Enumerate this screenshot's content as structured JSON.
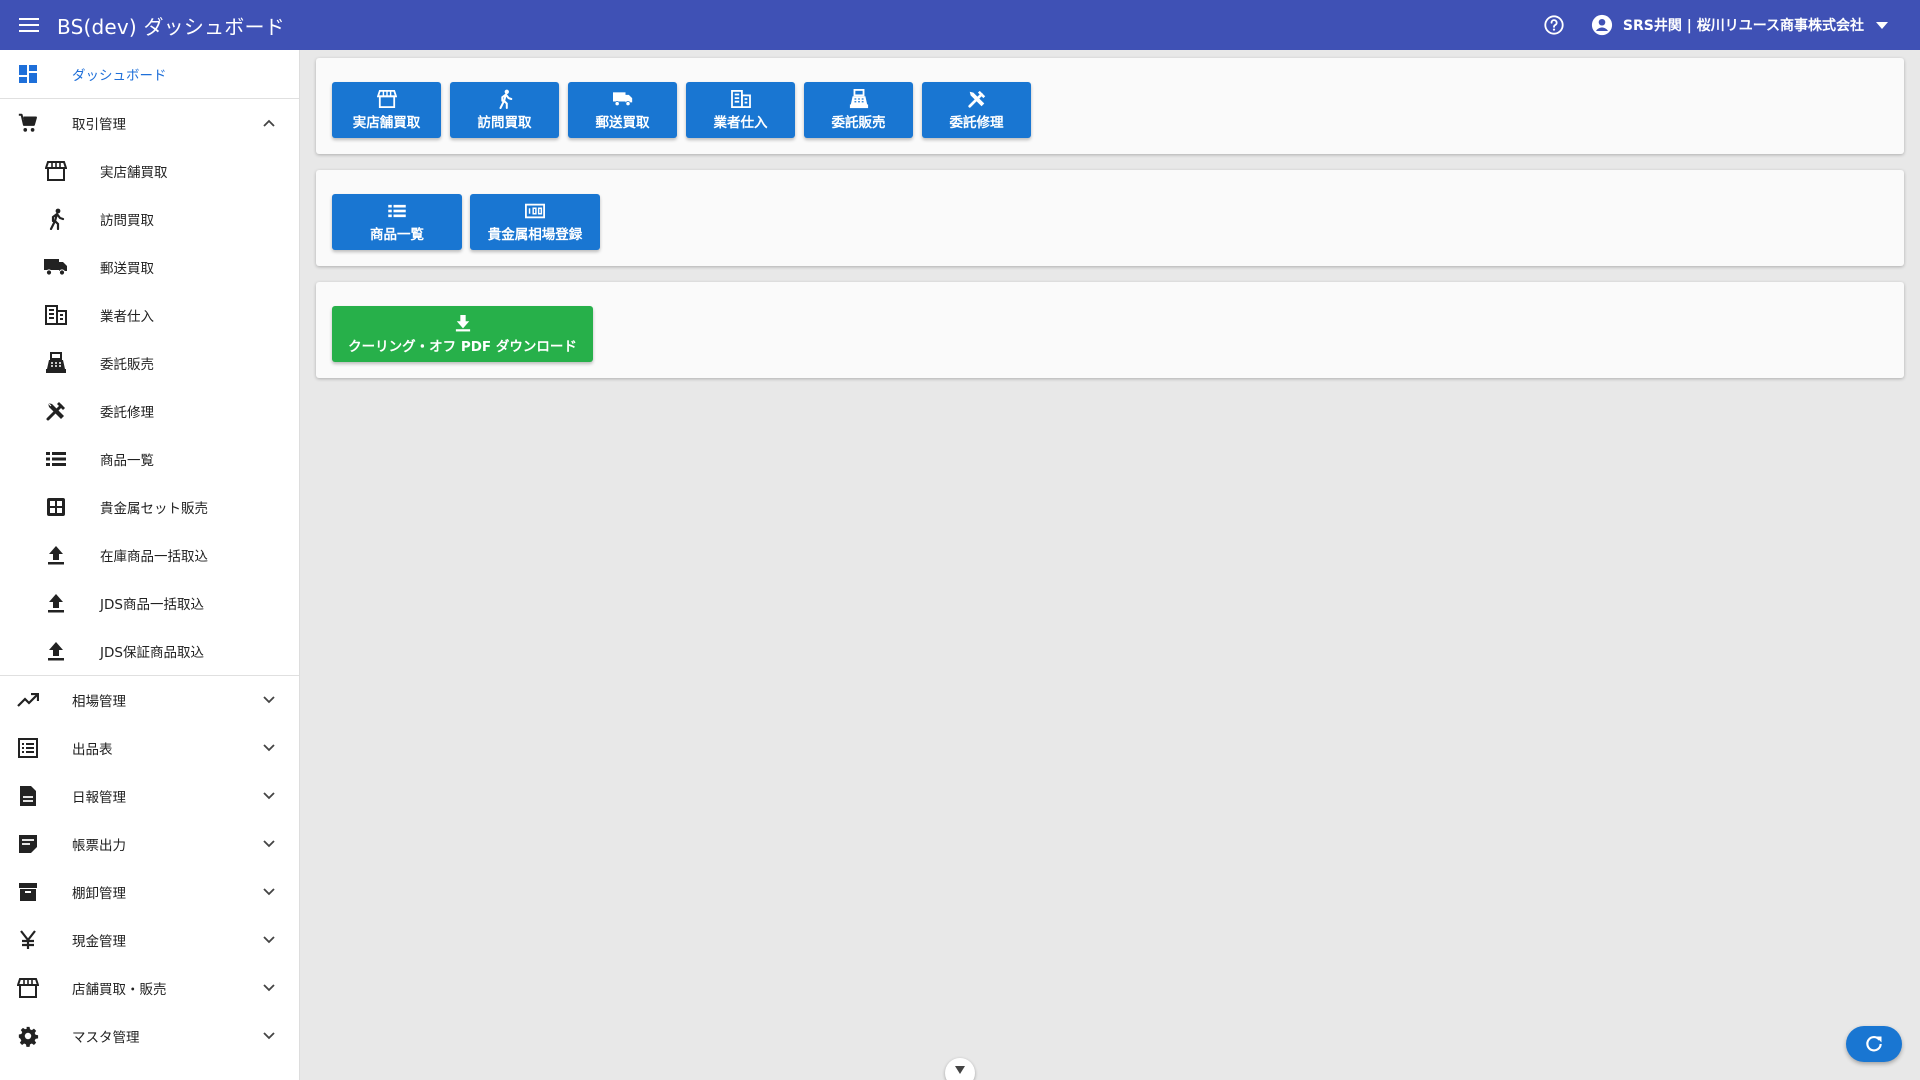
{
  "header": {
    "title": "BS(dev) ダッシュボード",
    "user_name": "SRS井関 | 桜川リユース商事株式会社"
  },
  "sidebar": {
    "dashboard": "ダッシュボード",
    "torihiki": {
      "label": "取引管理",
      "items": [
        {
          "label": "実店舗買取",
          "icon": "store-icon"
        },
        {
          "label": "訪問買取",
          "icon": "walk-icon"
        },
        {
          "label": "郵送買取",
          "icon": "truck-icon"
        },
        {
          "label": "業者仕入",
          "icon": "building-icon"
        },
        {
          "label": "委託販売",
          "icon": "register-icon"
        },
        {
          "label": "委託修理",
          "icon": "tools-icon"
        },
        {
          "label": "商品一覧",
          "icon": "list-icon"
        },
        {
          "label": "貴金属セット販売",
          "icon": "grid-icon"
        },
        {
          "label": "在庫商品一括取込",
          "icon": "upload-icon"
        },
        {
          "label": "JDS商品一括取込",
          "icon": "upload-icon"
        },
        {
          "label": "JDS保証商品取込",
          "icon": "upload-icon"
        }
      ]
    },
    "groups": [
      {
        "label": "相場管理",
        "icon": "trending-icon"
      },
      {
        "label": "出品表",
        "icon": "list-alt-icon"
      },
      {
        "label": "日報管理",
        "icon": "document-icon"
      },
      {
        "label": "帳票出力",
        "icon": "note-icon"
      },
      {
        "label": "棚卸管理",
        "icon": "archive-icon"
      },
      {
        "label": "現金管理",
        "icon": "yen-icon"
      },
      {
        "label": "店舗買取・販売",
        "icon": "store-icon"
      },
      {
        "label": "マスタ管理",
        "icon": "gear-icon"
      }
    ]
  },
  "main": {
    "row1": [
      "実店舗買取",
      "訪問買取",
      "郵送買取",
      "業者仕入",
      "委託販売",
      "委託修理"
    ],
    "row2": [
      "商品一覧",
      "貴金属相場登録"
    ],
    "row3": [
      "クーリング・オフ PDF ダウンロード"
    ]
  },
  "colors": {
    "appbar": "#3f51b5",
    "primary_button": "#1976d2",
    "green_button": "#27b04a",
    "active_nav": "#1e6fd9"
  }
}
